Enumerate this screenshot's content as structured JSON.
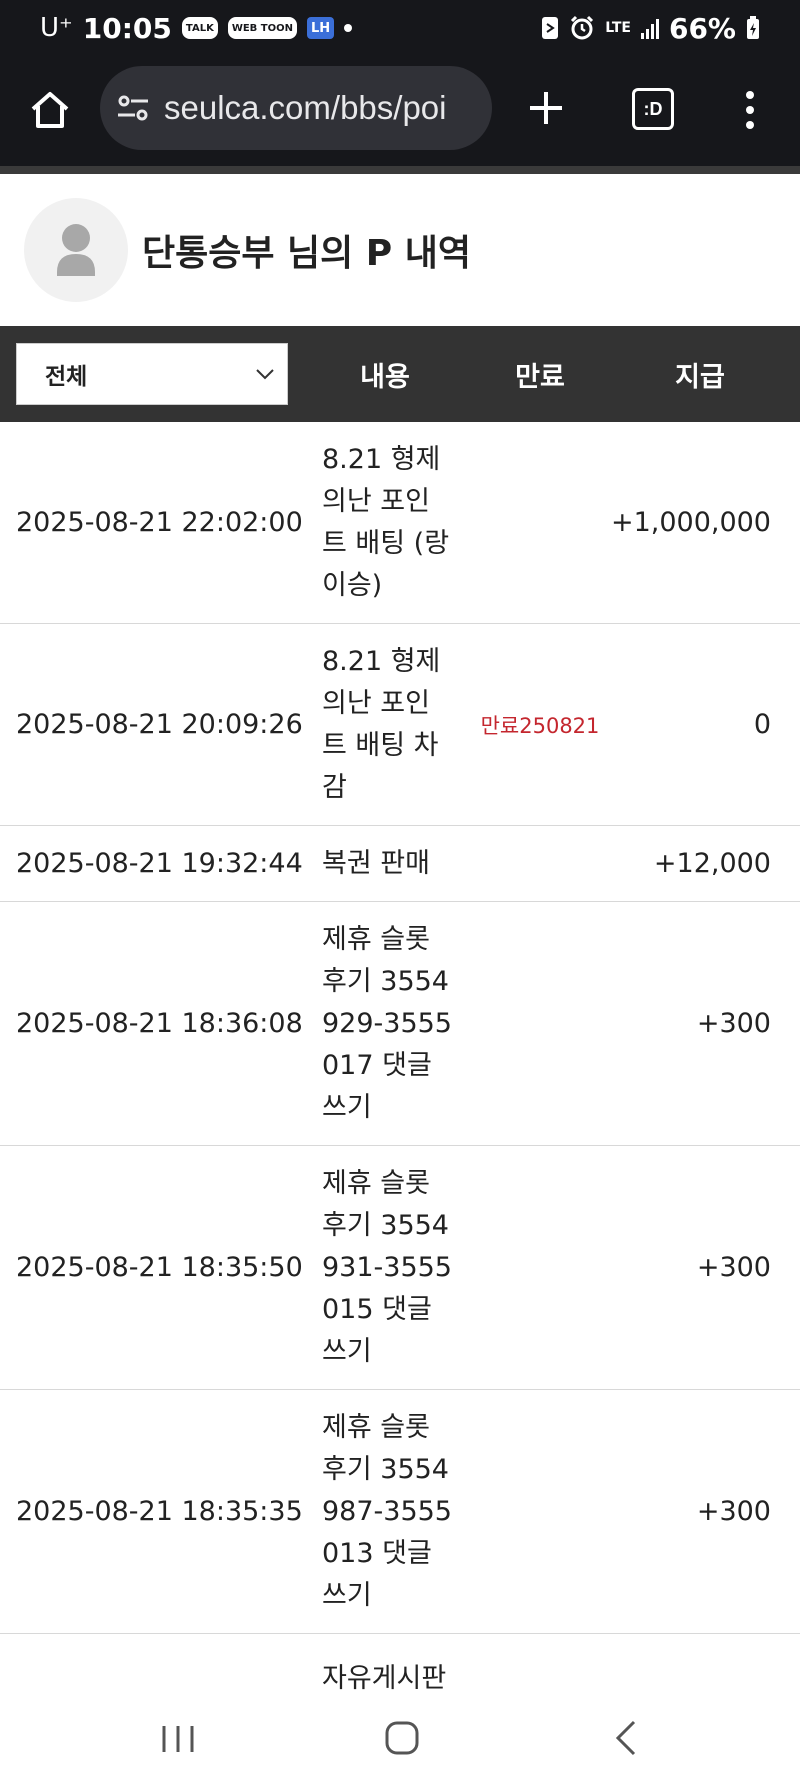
{
  "status_bar": {
    "carrier": "U⁺",
    "time": "10:05",
    "app_icons": [
      "TALK",
      "WEB TOON",
      "LH"
    ],
    "network": "LTE",
    "battery": "66%"
  },
  "browser": {
    "url": "seulca.com/bbs/poi",
    "tab_switcher_label": ":D"
  },
  "profile": {
    "title": "단통승부 님의 P 내역"
  },
  "table": {
    "filter_value": "전체",
    "headers": {
      "content": "내용",
      "expire": "만료",
      "pay": "지급"
    },
    "rows": [
      {
        "date": "2025-08-21 22:02:00",
        "content": "8.21 형제의난 포인트 배팅 (랑이승)",
        "expire": "",
        "amount": "+1,000,000"
      },
      {
        "date": "2025-08-21 20:09:26",
        "content": "8.21 형제의난 포인트 배팅 차감",
        "expire": "만료250821",
        "amount": "0"
      },
      {
        "date": "2025-08-21 19:32:44",
        "content": "복권 판매",
        "expire": "",
        "amount": "+12,000"
      },
      {
        "date": "2025-08-21 18:36:08",
        "content": "제휴 슬롯 후기 3554929-3555017 댓글쓰기",
        "expire": "",
        "amount": "+300"
      },
      {
        "date": "2025-08-21 18:35:50",
        "content": "제휴 슬롯 후기 3554931-3555015 댓글쓰기",
        "expire": "",
        "amount": "+300"
      },
      {
        "date": "2025-08-21 18:35:35",
        "content": "제휴 슬롯 후기 3554987-3555013 댓글쓰기",
        "expire": "",
        "amount": "+300"
      },
      {
        "date": "",
        "content": "자유게시판",
        "expire": "",
        "amount": ""
      }
    ]
  },
  "colors": {
    "status_bar_bg": "#16171b",
    "url_pill_bg": "#303137",
    "table_header_bg": "#333333",
    "expire_text": "#c4262e"
  }
}
